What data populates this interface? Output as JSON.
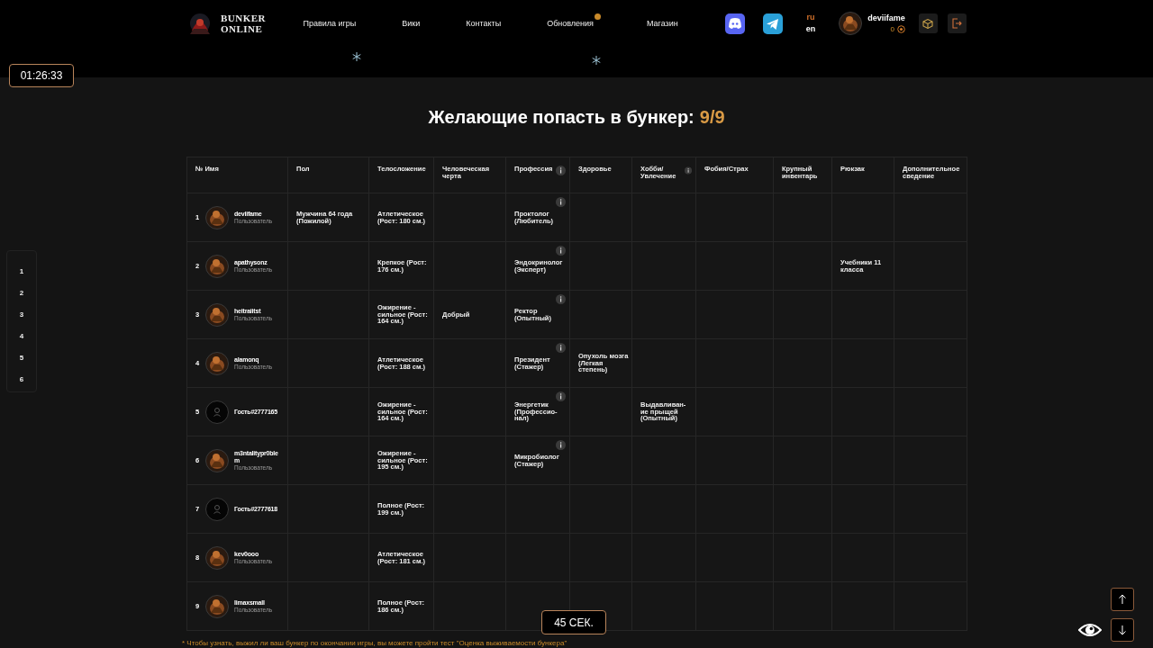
{
  "header": {
    "logo_lines": [
      "BUNKER",
      "ONLINE"
    ],
    "nav": [
      {
        "label": "Правила игры",
        "badge": false
      },
      {
        "label": "Вики",
        "badge": false
      },
      {
        "label": "Контакты",
        "badge": false
      },
      {
        "label": "Обновления",
        "badge": true
      },
      {
        "label": "Магазин",
        "badge": false
      }
    ],
    "languages": [
      {
        "label": "ru",
        "selected": true
      },
      {
        "label": "en",
        "selected": false
      }
    ],
    "user": {
      "name": "deviifame",
      "coins": "0"
    }
  },
  "timer": "01:26:33",
  "side_nav": [
    "1",
    "2",
    "3",
    "4",
    "5",
    "6"
  ],
  "title": "Желающие попасть в бункер:",
  "count": "9/9",
  "table": {
    "columns": [
      {
        "label": "№ Имя",
        "info": false
      },
      {
        "label": "Пол",
        "info": false
      },
      {
        "label": "Телосложение",
        "info": false
      },
      {
        "label": "Человеческая черта",
        "info": false
      },
      {
        "label": "Профессия",
        "info": true
      },
      {
        "label": "Здоровье",
        "info": false
      },
      {
        "label": "Хобби/ Увлечение",
        "info": true
      },
      {
        "label": "Фобия/Страх",
        "info": false
      },
      {
        "label": "Крупный инвентарь",
        "info": false
      },
      {
        "label": "Рюкзак",
        "info": false
      },
      {
        "label": "Дополнительное сведение",
        "info": false
      }
    ],
    "rows": [
      {
        "profession_info": true,
        "cells": [
          {
            "num": "1",
            "name": "deviifame",
            "kind": "user",
            "role": "Пользователь"
          },
          "Мужчина 64 года (Пожилой)",
          "Атлетическое (Рост: 180 см.)",
          null,
          "Проктолог (Любитель)",
          null,
          null,
          null,
          null,
          null,
          null
        ]
      },
      {
        "profession_info": true,
        "cells": [
          {
            "num": "2",
            "name": "apathysonz",
            "kind": "user",
            "role": "Пользователь"
          },
          null,
          "Крепкое (Рост: 176 см.)",
          null,
          "Эндокринолог (Эксперт)",
          null,
          null,
          null,
          null,
          "Учебники 11 класса",
          null
        ]
      },
      {
        "profession_info": true,
        "cells": [
          {
            "num": "3",
            "name": "heitraiitst",
            "kind": "user",
            "role": "Пользователь"
          },
          null,
          "Ожирение - сильное (Рост: 164 см.)",
          "Добрый",
          "Ректор (Опытный)",
          null,
          null,
          null,
          null,
          null,
          null
        ]
      },
      {
        "profession_info": true,
        "cells": [
          {
            "num": "4",
            "name": "alamonq",
            "kind": "user",
            "role": "Пользователь"
          },
          null,
          "Атлетическое (Рост: 188 см.)",
          null,
          "Президент (Стажер)",
          "Опухоль мозга (Легкая степень)",
          null,
          null,
          null,
          null,
          null
        ]
      },
      {
        "profession_info": true,
        "cells": [
          {
            "num": "5",
            "name": "Гость#2777165",
            "kind": "guest"
          },
          null,
          "Ожирение - сильное (Рост: 164 см.)",
          null,
          "Энергетик (Профессио-нал)",
          null,
          "Выдавливан-ие прыщей (Опытный)",
          null,
          null,
          null,
          null
        ]
      },
      {
        "profession_info": true,
        "cells": [
          {
            "num": "6",
            "name": "m3ntalitypr0blem",
            "kind": "user",
            "role": "Пользователь"
          },
          null,
          "Ожирение - сильное (Рост: 195 см.)",
          null,
          "Микробиолог (Стажер)",
          null,
          null,
          null,
          null,
          null,
          null
        ]
      },
      {
        "profession_info": false,
        "cells": [
          {
            "num": "7",
            "name": "Гость#2777618",
            "kind": "guest"
          },
          null,
          "Полное (Рост: 199 см.)",
          null,
          null,
          null,
          null,
          null,
          null,
          null,
          null
        ]
      },
      {
        "profession_info": false,
        "cells": [
          {
            "num": "8",
            "name": "kev0ooo",
            "kind": "user",
            "role": "Пользователь"
          },
          null,
          "Атлетическое (Рост: 181 см.)",
          null,
          null,
          null,
          null,
          null,
          null,
          null,
          null
        ]
      },
      {
        "profession_info": false,
        "cells": [
          {
            "num": "9",
            "name": "limaxsmall",
            "kind": "user",
            "role": "Пользователь"
          },
          null,
          "Полное (Рост: 186 см.)",
          null,
          null,
          null,
          null,
          null,
          null,
          null,
          null
        ]
      }
    ]
  },
  "countdown": "45 СЕК.",
  "note": "* Чтобы узнать, выжил ли ваш бункер по окончании игры, вы можете пройти тест \"Оценка выживаемости бункера\""
}
